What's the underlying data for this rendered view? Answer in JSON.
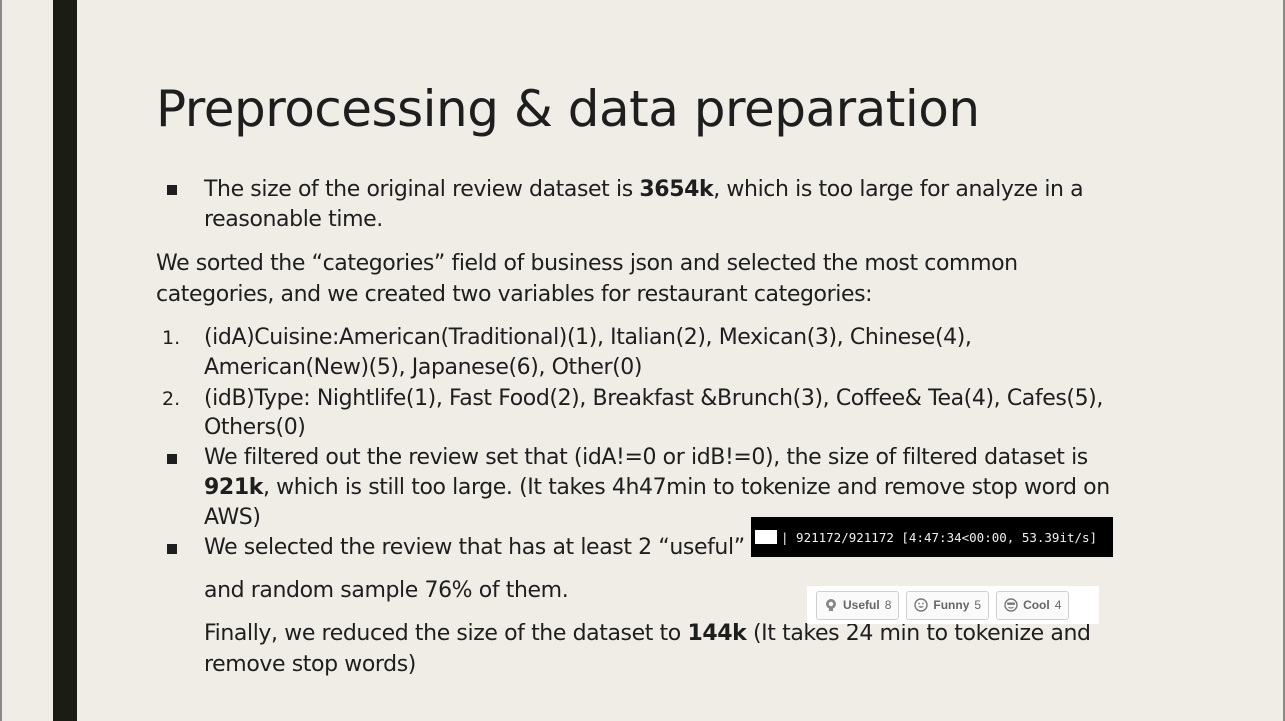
{
  "slide": {
    "title": "Preprocessing & data preparation",
    "b1_pre": "The size of the original review dataset is ",
    "b1_bold": "3654k",
    "b1_post": ", which is too large for analyze in a",
    "b1_line2": "reasonable time.",
    "para1_line1": "We sorted the “categories” field of  business json and selected the most common",
    "para1_line2": "categories, and we created two variables for restaurant categories:",
    "n1_marker": "1.",
    "n1_line1": "(idA)Cuisine:American(Traditional)(1), Italian(2), Mexican(3), Chinese(4),",
    "n1_line2": "American(New)(5), Japanese(6), Other(0)",
    "n2_marker": "2.",
    "n2_line1": "(idB)Type: Nightlife(1), Fast Food(2), Breakfast &Brunch(3), Coffee& Tea(4), Cafes(5),",
    "n2_line2": "Others(0)",
    "b2_line1": "We filtered out the review set that (idA!=0 or idB!=0), the size of filtered dataset is",
    "b2_bold": "921k",
    "b2_post": ", which is still too large. (It takes 4h47min to tokenize and remove stop word on",
    "b2_line3": "AWS)",
    "b3_line1": "We selected the review that has at least 2 “useful”",
    "b3_line2": "and random sample 76% of them.",
    "fin_pre": "Finally, we reduced the size of the dataset to ",
    "fin_bold": "144k",
    "fin_post": " (It takes 24 min to tokenize and",
    "fin_line2": "remove stop words)"
  },
  "terminal": {
    "progress_text": "| 921172/921172 [4:47:34<00:00, 53.39it/s]"
  },
  "votes": {
    "useful_label": "Useful",
    "useful_count": "8",
    "funny_label": "Funny",
    "funny_count": "5",
    "cool_label": "Cool",
    "cool_count": "4"
  },
  "colors": {
    "background": "#efede6",
    "accent_bar": "#1b1d14",
    "text": "#1e1e1e"
  }
}
